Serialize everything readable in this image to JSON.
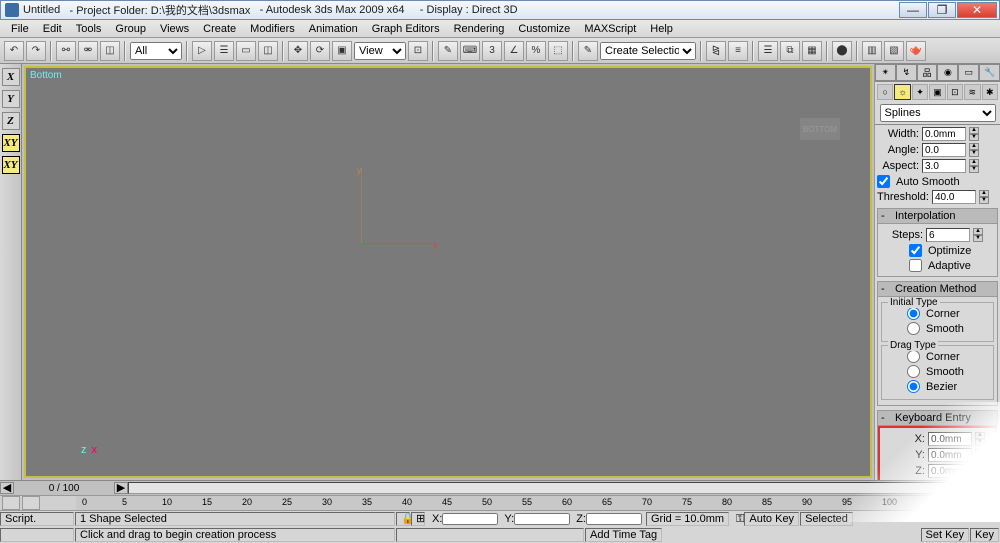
{
  "title": {
    "doc": "Untitled",
    "folder": "- Project Folder: D:\\我的文档\\3dsmax",
    "app": "- Autodesk 3ds Max  2009 x64",
    "disp": "- Display : Direct 3D"
  },
  "menu": [
    "File",
    "Edit",
    "Tools",
    "Group",
    "Views",
    "Create",
    "Modifiers",
    "Animation",
    "Graph Editors",
    "Rendering",
    "Customize",
    "MAXScript",
    "Help"
  ],
  "toolbar": {
    "all": "All",
    "view": "View",
    "csel": "Create Selection Set"
  },
  "viewport": {
    "label": "Bottom",
    "watermark": "BOTTOM",
    "y": "y",
    "x": "x",
    "tripod_z": "z",
    "tripod_x": "x"
  },
  "axes": [
    "X",
    "Y",
    "Z",
    "XY",
    "XY"
  ],
  "cmd": {
    "dd": "Splines",
    "width_l": "Width:",
    "width_v": "0.0mm",
    "angle_l": "Angle:",
    "angle_v": "0.0",
    "aspect_l": "Aspect:",
    "aspect_v": "3.0",
    "autosmooth": "Auto Smooth",
    "thresh_l": "Threshold:",
    "thresh_v": "40.0",
    "interp": "Interpolation",
    "steps_l": "Steps:",
    "steps_v": "6",
    "optimize": "Optimize",
    "adaptive": "Adaptive",
    "cmethod": "Creation Method",
    "itype": "Initial Type",
    "corner": "Corner",
    "smooth": "Smooth",
    "dtype": "Drag Type",
    "bezier": "Bezier",
    "kentry": "Keyboard Entry",
    "xl": "X:",
    "xv": "0.0mm",
    "yl": "Y:",
    "yv": "0.0mm",
    "zl": "Z:",
    "zv": "0.0mm"
  },
  "status": {
    "frames": "0 / 100",
    "selected": "1 Shape Selected",
    "hint": "Click and drag to begin creation process",
    "x": "X:",
    "y": "Y:",
    "z": "Z:",
    "grid": "Grid = 10.0mm",
    "addtag": "Add Time Tag",
    "autokey": "Auto Key",
    "selectedlbl": "Selected",
    "setkey": "Set Key",
    "keyf": "Key",
    "script": "Script."
  },
  "ruler_ticks": [
    0,
    5,
    10,
    15,
    20,
    25,
    30,
    35,
    40,
    45,
    50,
    55,
    60,
    65,
    70,
    75,
    80,
    85,
    90,
    95,
    100
  ]
}
